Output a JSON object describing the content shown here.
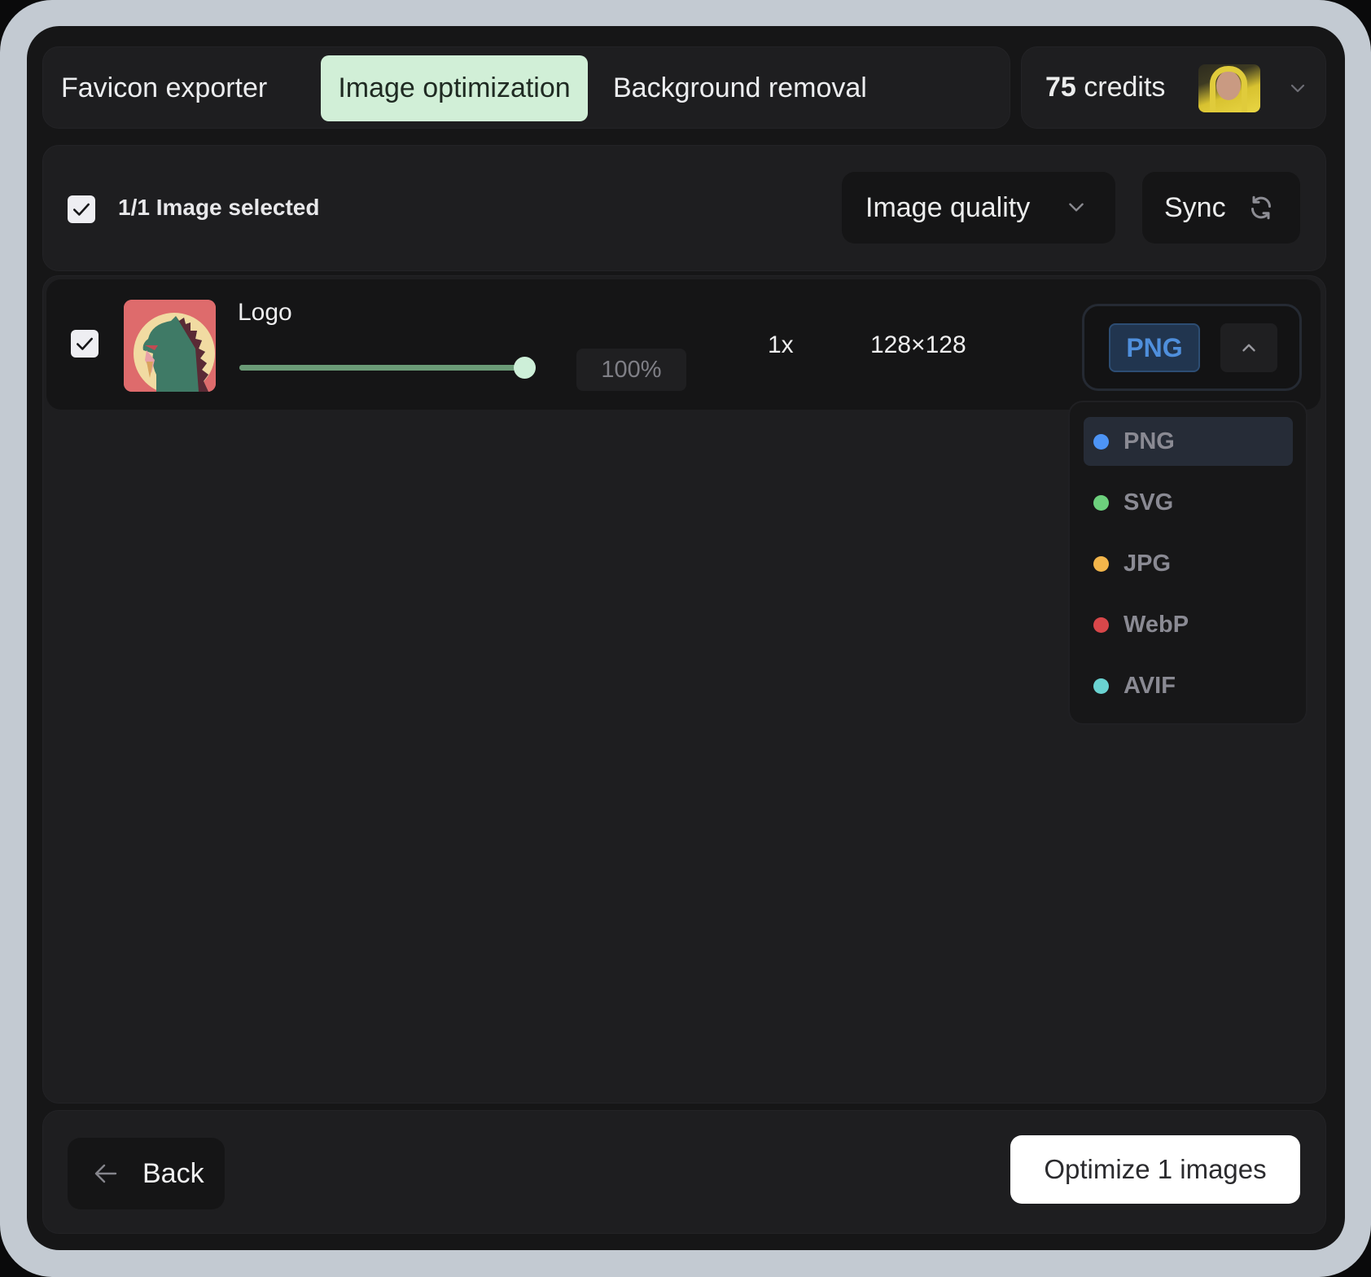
{
  "tabs": [
    {
      "label": "Favicon exporter",
      "active": false
    },
    {
      "label": "Image optimization",
      "active": true
    },
    {
      "label": "Background removal",
      "active": false
    }
  ],
  "account": {
    "credits_count": "75",
    "credits_label": " credits",
    "avatar": "user-avatar-photo",
    "menu_icon": "chevron-down-icon"
  },
  "selection": {
    "checked": true,
    "label": "1/1 Image selected",
    "quality_label": "Image quality",
    "quality_icon": "chevron-down-icon",
    "sync_label": "Sync",
    "sync_icon": "refresh-icon"
  },
  "images": [
    {
      "checked": true,
      "name": "Logo",
      "thumbnail": "godzilla-ice-cream-logo",
      "quality_percent": 100,
      "quality_label": "100%",
      "scale": "1x",
      "dimensions": "128×128",
      "format": "PNG",
      "format_toggle_icon": "chevron-up-icon"
    }
  ],
  "format_dropdown": {
    "open": true,
    "selected": "PNG",
    "options": [
      {
        "label": "PNG",
        "color": "#4d94f5"
      },
      {
        "label": "SVG",
        "color": "#6dd17d"
      },
      {
        "label": "JPG",
        "color": "#f3b64b"
      },
      {
        "label": "WebP",
        "color": "#d9474a"
      },
      {
        "label": "AVIF",
        "color": "#6ad3d1"
      }
    ]
  },
  "footer": {
    "back_label": "Back",
    "back_icon": "arrow-left-icon",
    "optimize_label": "Optimize 1 images"
  },
  "colors": {
    "accent_tab": "#d1efd7",
    "slider": "#6b9b77",
    "slider_thumb": "#cdefd8",
    "format_pill_text": "#4f8fdc"
  }
}
